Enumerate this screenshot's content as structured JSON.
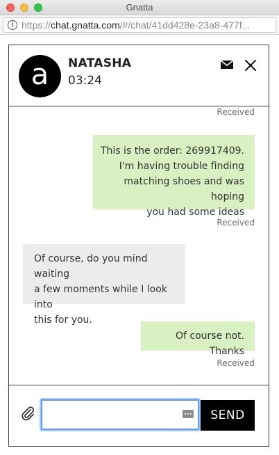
{
  "window": {
    "title": "Gnatta"
  },
  "urlbar": {
    "scheme": "https://",
    "host": "chat.gnatta.com",
    "path": "/#/chat/41dd428e-23a8-477f..."
  },
  "header": {
    "avatar_letter": "a",
    "agent_name": "NATASHA",
    "timer": "03:24",
    "icons": [
      "mail-icon",
      "close-icon"
    ]
  },
  "messages": [
    {
      "status": "Received"
    },
    {
      "direction": "out",
      "lines": [
        "This is the order: 269917409.",
        "I'm having trouble finding",
        "matching shoes and was hoping",
        "you had some ideas"
      ],
      "status": "Received"
    },
    {
      "direction": "in",
      "lines": [
        "Of course, do you mind waiting",
        "a few moments while I look into",
        "this for you."
      ]
    },
    {
      "direction": "out",
      "lines": [
        "Of course not. Thanks"
      ],
      "status": "Received"
    }
  ],
  "composer": {
    "value": "",
    "placeholder": "",
    "send_label": "SEND",
    "icons": [
      "paperclip-icon",
      "keyboard-dots-icon"
    ]
  },
  "colors": {
    "outgoing_bubble": "#d8f0c2",
    "incoming_bubble": "#ececec",
    "send_button": "#000000",
    "input_focus": "#5b9cf0"
  }
}
